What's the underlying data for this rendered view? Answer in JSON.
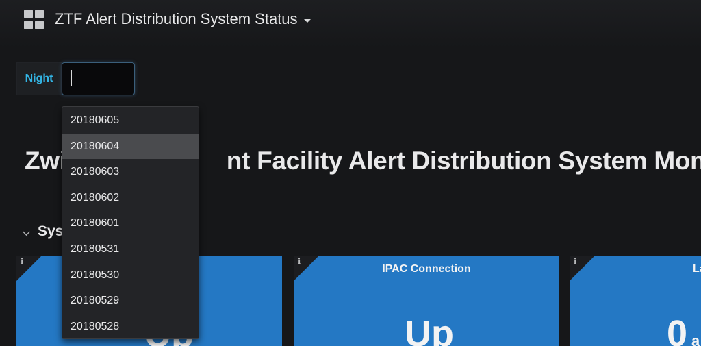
{
  "header": {
    "dashboard_title": "ZTF Alert Distribution System Status",
    "apps_icon": "grid-apps-icon",
    "title_caret_icon": "caret-down-icon"
  },
  "variables": {
    "night": {
      "label": "Night",
      "value": "",
      "options": [
        "20180605",
        "20180604",
        "20180603",
        "20180602",
        "20180601",
        "20180531",
        "20180530",
        "20180529",
        "20180528"
      ],
      "highlighted": "20180604"
    }
  },
  "text_panel": {
    "heading_visible_left": "Zwi",
    "heading_visible_right": "nt Facility Alert Distribution System Monitor"
  },
  "row": {
    "title_visible": "Sys",
    "collapse_icon": "chevron-down-icon"
  },
  "panels": [
    {
      "info": "i",
      "title": "",
      "value": "Up"
    },
    {
      "info": "i",
      "title": "IPAC Connection",
      "value": "Up"
    },
    {
      "info": "i",
      "title": "La",
      "value": "0",
      "unit": "a"
    }
  ],
  "colors": {
    "panel_blue": "#2478c4",
    "label_cyan": "#33b5e5",
    "background": "#161719"
  }
}
